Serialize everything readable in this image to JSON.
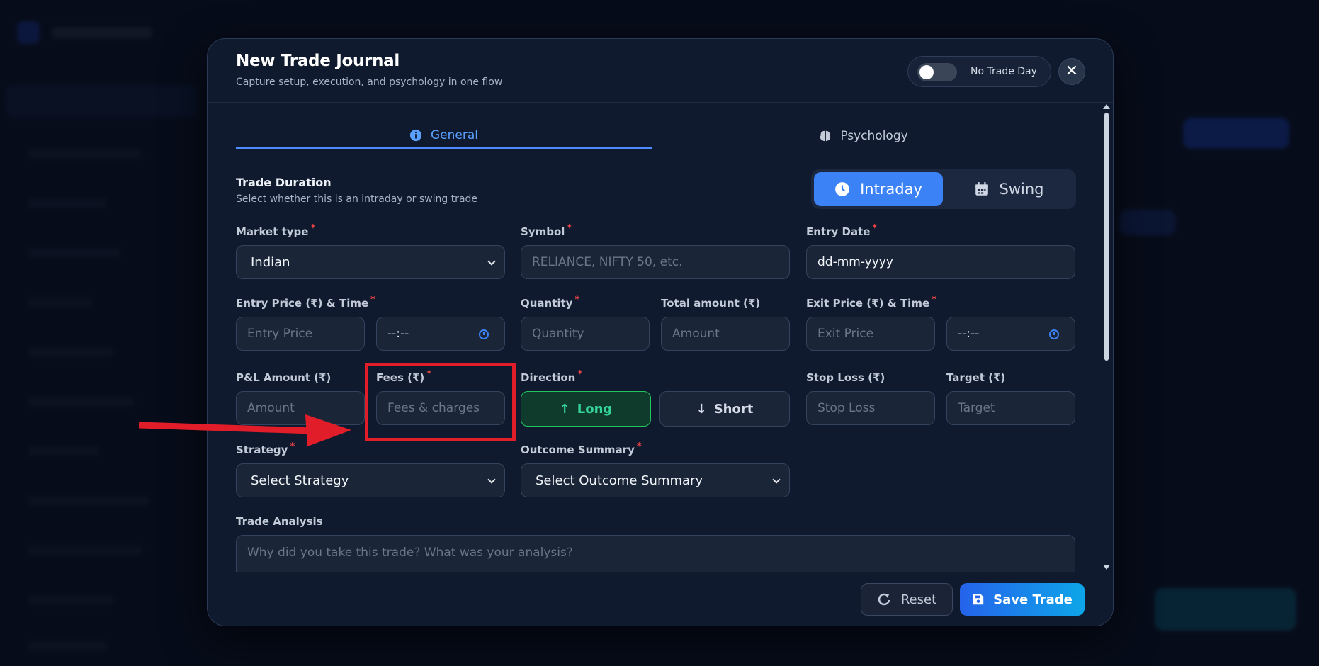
{
  "modal": {
    "title": "New Trade Journal",
    "subtitle": "Capture setup, execution, and psychology in one flow",
    "no_trade_day_label": "No Trade Day",
    "close_symbol": "✕"
  },
  "tabs": {
    "general": "General",
    "psychology": "Psychology"
  },
  "duration": {
    "title": "Trade Duration",
    "subtitle": "Select whether this is an intraday or swing trade",
    "intraday": "Intraday",
    "swing": "Swing"
  },
  "fields": {
    "market_type": {
      "label": "Market type",
      "value": "Indian"
    },
    "symbol": {
      "label": "Symbol",
      "placeholder": "RELIANCE, NIFTY 50, etc."
    },
    "entry_date": {
      "label": "Entry Date",
      "value": "dd-mm-yyyy"
    },
    "entry_price": {
      "label": "Entry Price (₹) & Time",
      "placeholder": "Entry Price",
      "time_value": "--:--"
    },
    "quantity": {
      "label": "Quantity",
      "placeholder": "Quantity"
    },
    "total_amount": {
      "label": "Total amount (₹)",
      "placeholder": "Amount"
    },
    "exit_price": {
      "label": "Exit Price (₹) & Time",
      "placeholder": "Exit Price",
      "time_value": "--:--"
    },
    "pnl": {
      "label": "P&L Amount (₹)",
      "placeholder": "Amount"
    },
    "fees": {
      "label": "Fees (₹)",
      "placeholder": "Fees & charges"
    },
    "direction": {
      "label": "Direction",
      "long": "Long",
      "short": "Short"
    },
    "stop_loss": {
      "label": "Stop Loss (₹)",
      "placeholder": "Stop Loss"
    },
    "target": {
      "label": "Target (₹)",
      "placeholder": "Target"
    },
    "strategy": {
      "label": "Strategy",
      "value": "Select Strategy"
    },
    "outcome": {
      "label": "Outcome Summary",
      "value": "Select Outcome Summary"
    },
    "analysis": {
      "label": "Trade Analysis",
      "placeholder": "Why did you take this trade? What was your analysis?"
    }
  },
  "required_mark": "*",
  "footer": {
    "reset": "Reset",
    "save": "Save Trade"
  },
  "colors": {
    "accent": "#3b82f6",
    "long": "#22c55e",
    "annotation": "#e11d2a"
  }
}
